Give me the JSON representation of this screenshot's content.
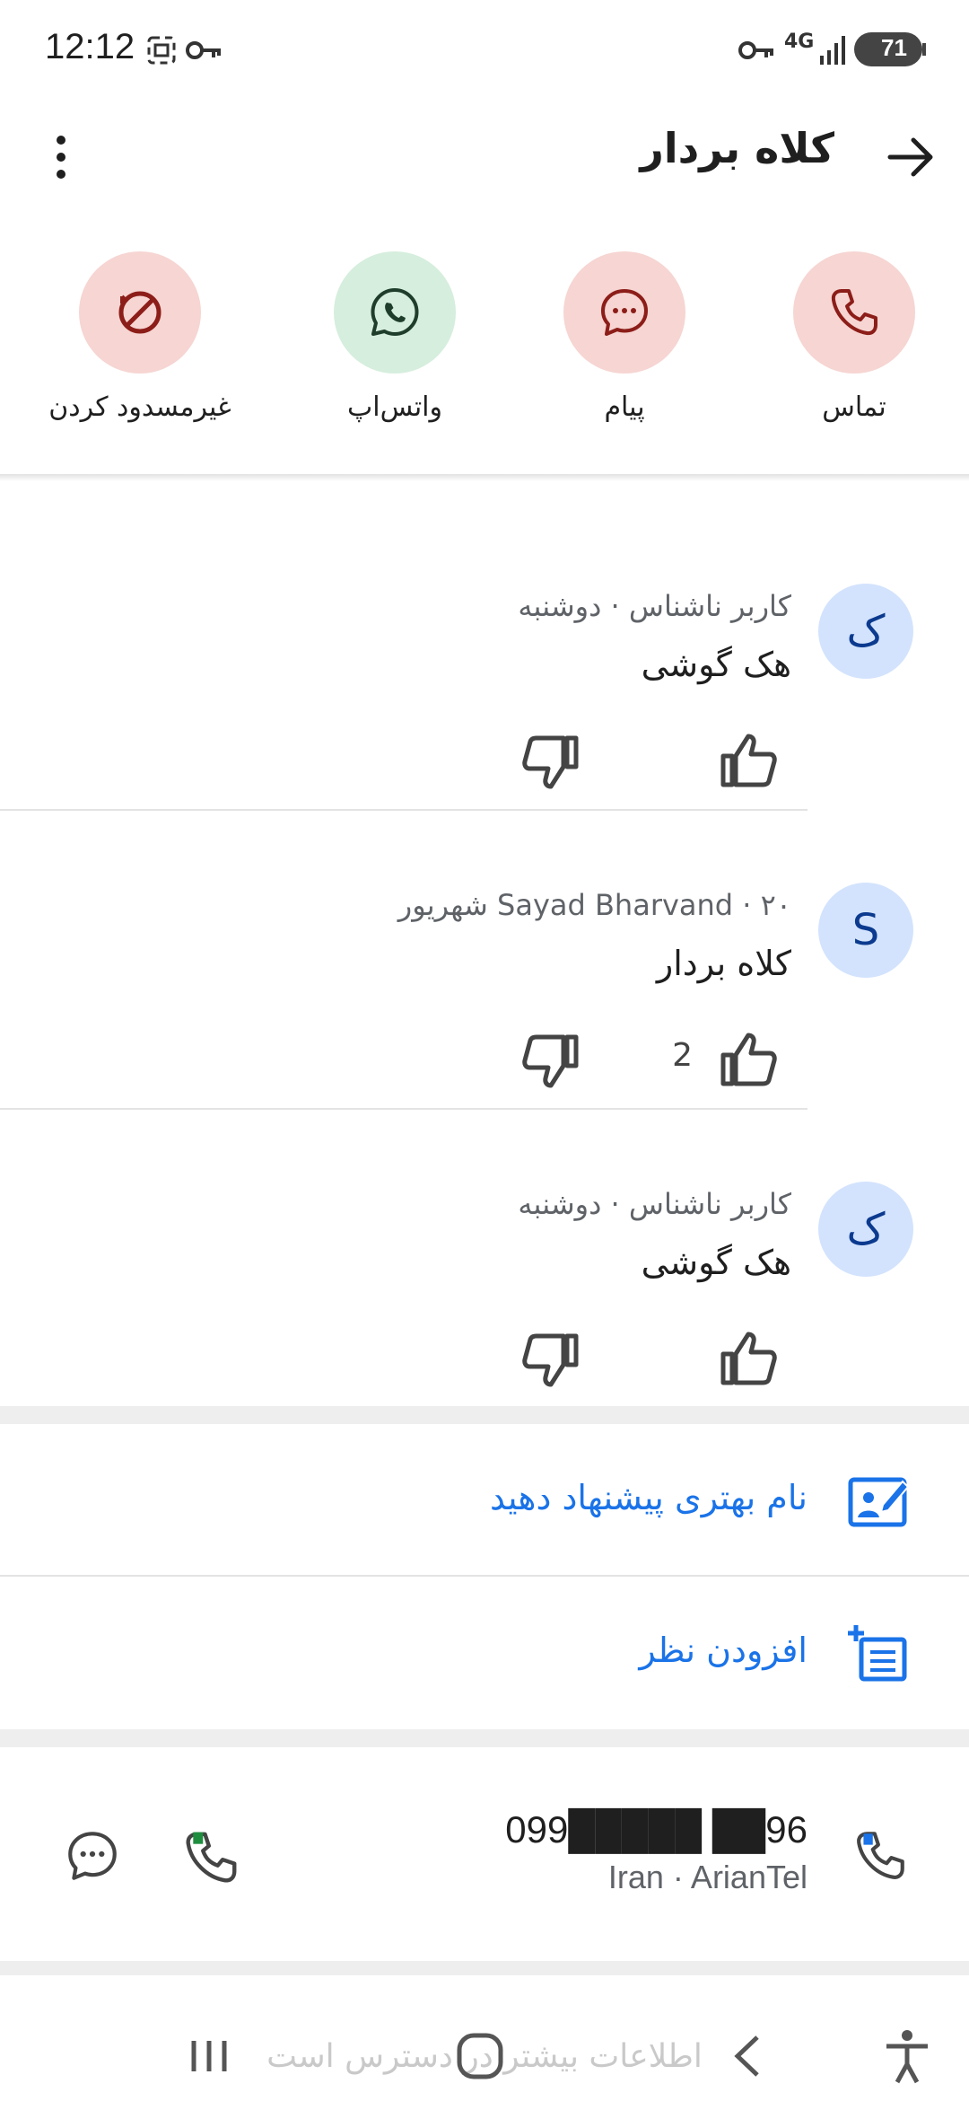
{
  "status_bar": {
    "time": "12:12",
    "network": "4G",
    "battery": "71"
  },
  "app_bar": {
    "title": "کلاه بردار"
  },
  "actions": [
    {
      "id": "call",
      "label": "تماس",
      "bg": "#f6d5d2",
      "fg": "#8c1d18"
    },
    {
      "id": "message",
      "label": "پیام",
      "bg": "#f6d5d2",
      "fg": "#8c1d18"
    },
    {
      "id": "whatsapp",
      "label": "واتس‌اپ",
      "bg": "#d6eedd",
      "fg": "#1f3d2b"
    },
    {
      "id": "unblock",
      "label": "غیرمسدود کردن",
      "bg": "#f6d5d2",
      "fg": "#8c1d18"
    }
  ],
  "reviews": [
    {
      "avatar": "ک",
      "meta": "کاربر ناشناس · دوشنبه",
      "text": "هک گوشی",
      "likes": ""
    },
    {
      "avatar": "S",
      "meta": "Sayad Bharvand · ۲۰ شهریور",
      "text": "کلاه بردار",
      "likes": "2"
    },
    {
      "avatar": "ک",
      "meta": "کاربر ناشناس · دوشنبه",
      "text": "هک گوشی",
      "likes": ""
    }
  ],
  "links": {
    "suggest_name": "نام بهتری پیشنهاد دهید",
    "add_comment": "افزودن نظر"
  },
  "phone": {
    "number": "099█████ ██96",
    "carrier": "Iran · ArianTel"
  },
  "more_info": "اطلاعات بیشتر در دسترس است",
  "colors": {
    "accent": "#1a73e8",
    "avatar_bg": "#d3e3fd",
    "red_action": "#f6d5d2",
    "green_action": "#d6eedd"
  }
}
